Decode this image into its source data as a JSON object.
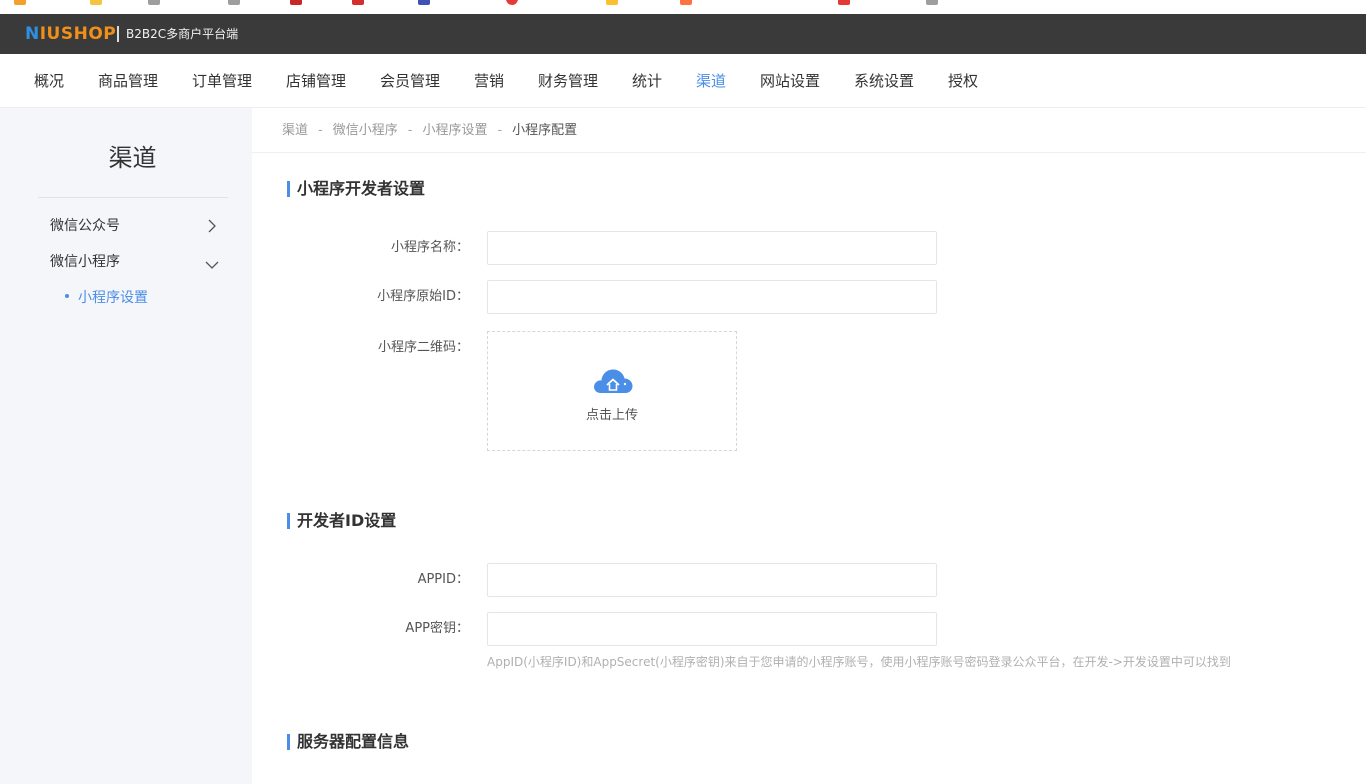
{
  "app": {
    "logo_first": "N",
    "logo_rest": "IUSHOP",
    "platform": "B2B2C多商户平台端"
  },
  "nav": {
    "items": [
      {
        "label": "概况"
      },
      {
        "label": "商品管理"
      },
      {
        "label": "订单管理"
      },
      {
        "label": "店铺管理"
      },
      {
        "label": "会员管理"
      },
      {
        "label": "营销"
      },
      {
        "label": "财务管理"
      },
      {
        "label": "统计"
      },
      {
        "label": "渠道"
      },
      {
        "label": "网站设置"
      },
      {
        "label": "系统设置"
      },
      {
        "label": "授权"
      }
    ],
    "active": "渠道"
  },
  "sidebar": {
    "title": "渠道",
    "items": [
      {
        "label": "微信公众号",
        "icon": "chevron-right-icon"
      },
      {
        "label": "微信小程序",
        "icon": "chevron-down-icon"
      }
    ],
    "sub_item": "小程序设置"
  },
  "breadcrumb": {
    "items": [
      "渠道",
      "微信小程序",
      "小程序设置",
      "小程序配置"
    ],
    "separator": "-"
  },
  "sections": {
    "developer": {
      "title": "小程序开发者设置",
      "name_label": "小程序名称：",
      "name_value": "",
      "origin_id_label": "小程序原始ID：",
      "origin_id_value": "",
      "qrcode_label": "小程序二维码：",
      "upload_text": "点击上传",
      "upload_icon": "cloud-upload-icon"
    },
    "dev_id": {
      "title": "开发者ID设置",
      "appid_label": "APPID：",
      "appid_value": "",
      "secret_label": "APP密钥：",
      "secret_value": "",
      "hint": "AppID(小程序ID)和AppSecret(小程序密钥)来自于您申请的小程序账号，使用小程序账号密码登录公众平台，在开发->开发设置中可以找到"
    },
    "server": {
      "title": "服务器配置信息"
    }
  },
  "colors": {
    "accent": "#4a8ee8",
    "header_bg": "#3a3a3a",
    "sidebar_bg": "#f5f6fa",
    "logo_orange": "#f08f19"
  }
}
